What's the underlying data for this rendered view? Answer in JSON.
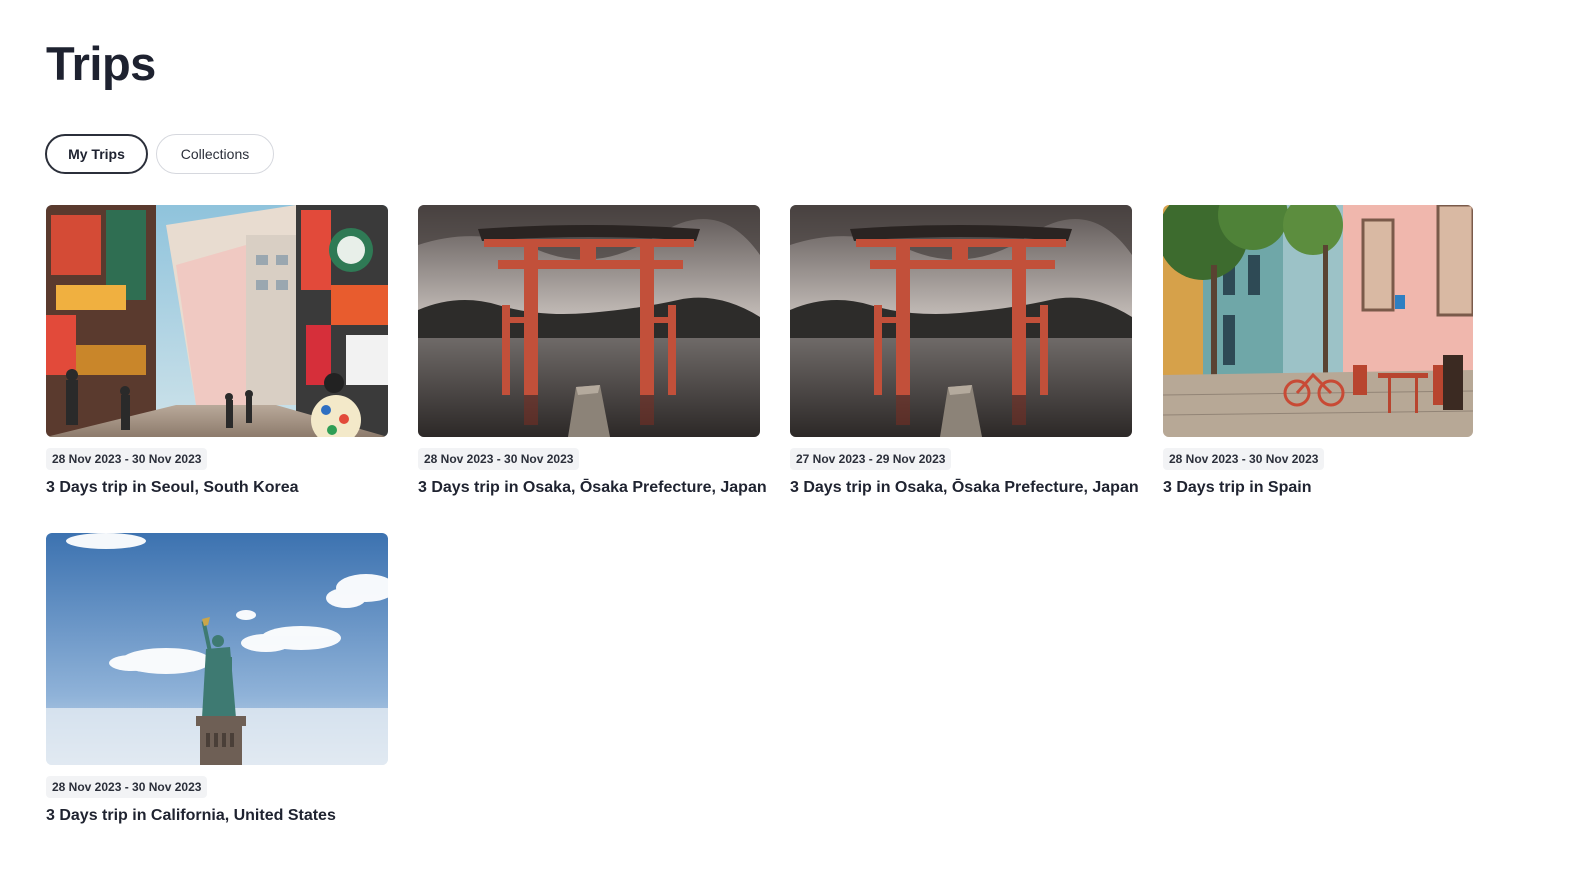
{
  "page": {
    "title": "Trips"
  },
  "tabs": [
    {
      "label": "My Trips",
      "active": true
    },
    {
      "label": "Collections",
      "active": false
    }
  ],
  "trips": [
    {
      "dates": "28 Nov 2023 - 30 Nov 2023",
      "title": "3 Days trip in Seoul, South Korea",
      "image": "seoul-street-photo"
    },
    {
      "dates": "28 Nov 2023 - 30 Nov 2023",
      "title": "3 Days trip in Osaka, Ōsaka Prefecture, Japan",
      "image": "torii-gate-lake-photo"
    },
    {
      "dates": "27 Nov 2023 - 29 Nov 2023",
      "title": "3 Days trip in Osaka, Ōsaka Prefecture, Japan",
      "image": "torii-gate-lake-photo"
    },
    {
      "dates": "28 Nov 2023 - 30 Nov 2023",
      "title": "3 Days trip in Spain",
      "image": "spanish-street-cafe-photo"
    },
    {
      "dates": "28 Nov 2023 - 30 Nov 2023",
      "title": "3 Days trip in California, United States",
      "image": "statue-of-liberty-photo"
    }
  ],
  "colors": {
    "text": "#1f2330",
    "badge_bg": "#f2f3f5",
    "tab_border_active": "#2b2f3a",
    "tab_border_inactive": "#d6d8de"
  }
}
